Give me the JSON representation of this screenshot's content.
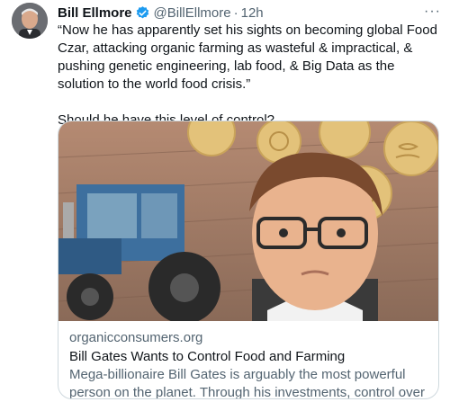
{
  "author": {
    "name": "Bill Ellmore",
    "handle": "@BillEllmore",
    "separator": "·",
    "time": "12h",
    "verified": true
  },
  "more_icon": "···",
  "tweet": {
    "text": "“Now he has apparently set his sights on becoming global Food Czar, attacking organic farming as wasteful & impractical, & pushing genetic engineering, lab food, & Big Data as the solution to the world food crisis.”",
    "question": "Should he have this level of control?"
  },
  "card": {
    "domain": "organicconsumers.org",
    "title": "Bill Gates Wants to Control Food and Farming",
    "description": "Mega-billionaire Bill Gates is arguably the most powerful person on the planet. Through his investments, control over patents, and so-..."
  },
  "colors": {
    "verified_badge": "#1d9bf0",
    "secondary_text": "#536471",
    "border": "#cfd9de",
    "gear": "#e3c27a",
    "tractor": "#3d6f9e"
  },
  "icons": [
    "verified-badge-icon",
    "more-options-icon"
  ]
}
